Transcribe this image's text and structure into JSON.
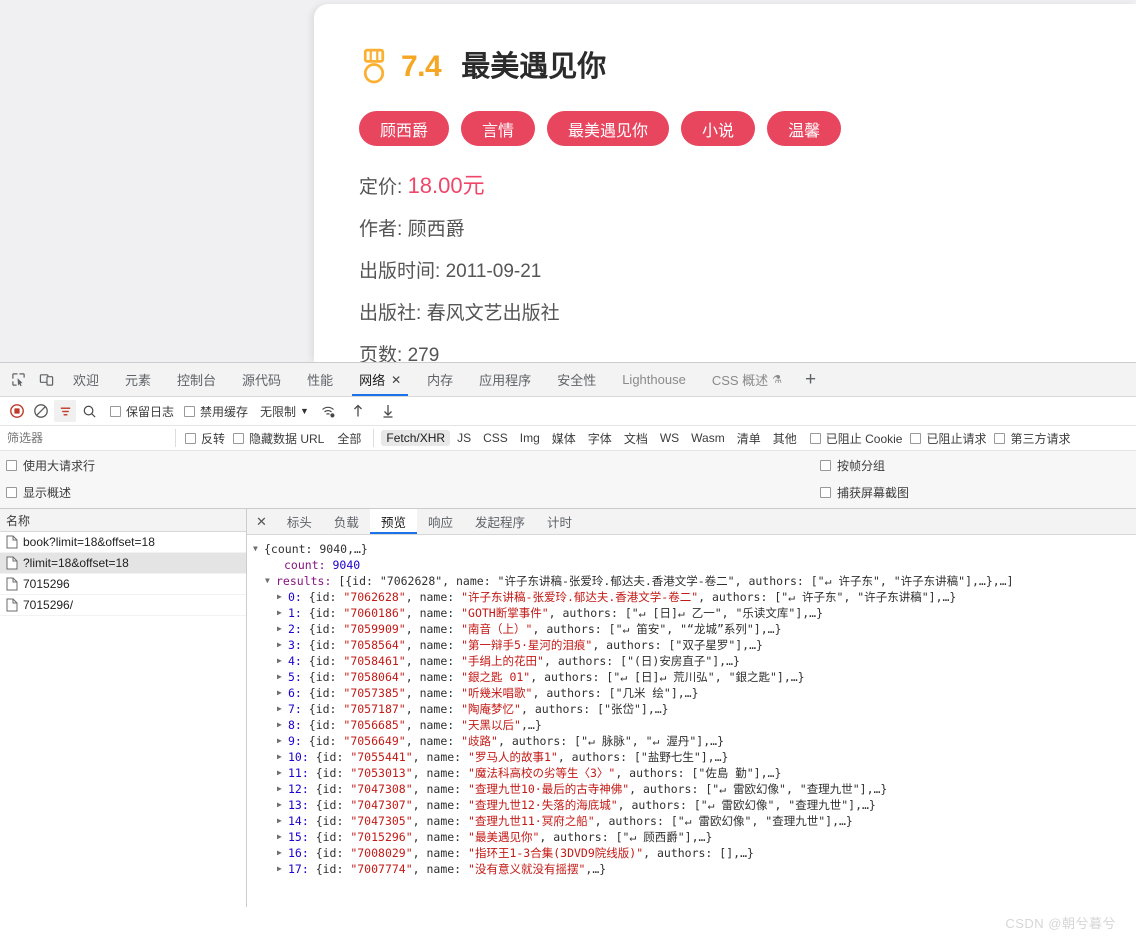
{
  "page": {
    "book": {
      "score": "7.4",
      "title": "最美遇见你",
      "medal_icon": "medal-icon",
      "tags": [
        "顾西爵",
        "言情",
        "最美遇见你",
        "小说",
        "温馨"
      ],
      "meta": [
        {
          "label": "定价:",
          "value": "18.00元",
          "highlight": true
        },
        {
          "label": "作者:",
          "value": "顾西爵",
          "highlight": false
        },
        {
          "label": "出版时间:",
          "value": "2011-09-21",
          "highlight": false
        },
        {
          "label": "出版社:",
          "value": "春风文艺出版社",
          "highlight": false
        },
        {
          "label": "页数:",
          "value": "279",
          "highlight": false
        }
      ],
      "colors": {
        "tag_bg": "#e8455f",
        "price": "#f0466a",
        "score": "#f5a623"
      }
    }
  },
  "devtools": {
    "tabs": [
      {
        "label": "欢迎",
        "active": false,
        "muted": false,
        "closable": false
      },
      {
        "label": "元素",
        "active": false,
        "muted": false,
        "closable": false
      },
      {
        "label": "控制台",
        "active": false,
        "muted": false,
        "closable": false
      },
      {
        "label": "源代码",
        "active": false,
        "muted": false,
        "closable": false
      },
      {
        "label": "性能",
        "active": false,
        "muted": false,
        "closable": false
      },
      {
        "label": "网络",
        "active": true,
        "muted": false,
        "closable": true,
        "close_label": "✕"
      },
      {
        "label": "内存",
        "active": false,
        "muted": false,
        "closable": false
      },
      {
        "label": "应用程序",
        "active": false,
        "muted": false,
        "closable": false
      },
      {
        "label": "安全性",
        "active": false,
        "muted": false,
        "closable": false
      },
      {
        "label": "Lighthouse",
        "active": false,
        "muted": true,
        "closable": false
      },
      {
        "label": "CSS 概述",
        "active": false,
        "muted": true,
        "closable": false,
        "flask": "⚗"
      }
    ],
    "add_tab_label": "+",
    "controls": {
      "record_icon": "record-stop-icon",
      "clear_icon": "clear-icon",
      "filter_icon": "filter-icon",
      "search_icon": "search-icon",
      "preserve_log": "保留日志",
      "disable_cache": "禁用缓存",
      "throttle_value": "无限制",
      "throttle_caret": "▼",
      "wifi_icon": "network-conditions-icon",
      "import_icon": "import-har-icon",
      "export_icon": "export-har-icon"
    },
    "filterbar": {
      "placeholder": "筛选器",
      "value": "",
      "invert": "反转",
      "hide_data_urls": "隐藏数据 URL",
      "types": [
        "全部",
        "Fetch/XHR",
        "JS",
        "CSS",
        "Img",
        "媒体",
        "字体",
        "文档",
        "WS",
        "Wasm",
        "清单",
        "其他"
      ],
      "active_type": "Fetch/XHR",
      "blocked_cookies": "已阻止 Cookie",
      "blocked_requests": "已阻止请求",
      "third_party": "第三方请求"
    },
    "options": {
      "big_request_rows": "使用大请求行",
      "show_overview": "显示概述",
      "group_by_frame": "按帧分组",
      "capture_screenshots": "捕获屏幕截图"
    },
    "request_list": {
      "header": "名称",
      "rows": [
        {
          "name": "book?limit=18&offset=18",
          "selected": false
        },
        {
          "name": "?limit=18&offset=18",
          "selected": true
        },
        {
          "name": "7015296",
          "selected": false
        },
        {
          "name": "7015296/",
          "selected": false
        }
      ]
    },
    "detail": {
      "close_label": "✕",
      "tabs": [
        "标头",
        "负载",
        "预览",
        "响应",
        "发起程序",
        "计时"
      ],
      "active_tab": "预览"
    }
  },
  "preview": {
    "root_line": {
      "indent": 0,
      "tri": "open",
      "text": "{count: 9040,…}"
    },
    "count_line": {
      "indent": 1,
      "key": "count: ",
      "value": "9040"
    },
    "results_line": {
      "indent": 1,
      "tri": "open",
      "key": "results: ",
      "text": "[{id: \"7062628\", name: \"许子东讲稿-张爱玲.郁达夫.香港文学-卷二\", authors: [\"↵ 许子东\", \"许子东讲稿\"],…},…]"
    },
    "items": [
      {
        "index": "0",
        "id": "7062628",
        "name": "许子东讲稿-张爱玲.郁达夫.香港文学-卷二",
        "authors": "[\"↵ 许子东\", \"许子东讲稿\"],…}"
      },
      {
        "index": "1",
        "id": "7060186",
        "name": "GOTH断掌事件",
        "authors": "[\"↵ [日]↵ 乙一\", \"乐读文库\"],…}"
      },
      {
        "index": "2",
        "id": "7059909",
        "name": "南音（上）",
        "authors": "[\"↵ 笛安\", \"“龙城”系列\"],…}"
      },
      {
        "index": "3",
        "id": "7058564",
        "name": "第一辩手5·星河的泪痕",
        "authors": "[\"双子星罗\"],…}"
      },
      {
        "index": "4",
        "id": "7058461",
        "name": "手绢上的花田",
        "authors": "[\"(日)安房直子\"],…}"
      },
      {
        "index": "5",
        "id": "7058064",
        "name": "銀之匙 01",
        "authors": "[\"↵ [日]↵ 荒川弘\", \"銀之匙\"],…}"
      },
      {
        "index": "6",
        "id": "7057385",
        "name": "听幾米唱歌",
        "authors": "[\"几米 绘\"],…}"
      },
      {
        "index": "7",
        "id": "7057187",
        "name": "陶庵梦忆",
        "authors": "[\"张岱\"],…}"
      },
      {
        "index": "8",
        "id": "7056685",
        "name": "天黑以后",
        "authors": null
      },
      {
        "index": "9",
        "id": "7056649",
        "name": "歧路",
        "authors": "[\"↵ 脉脉\", \"↵ 渥丹\"],…}"
      },
      {
        "index": "10",
        "id": "7055441",
        "name": "罗马人的故事1",
        "authors": "[\"盐野七生\"],…}"
      },
      {
        "index": "11",
        "id": "7053013",
        "name": "魔法科高校の劣等生〈3〉",
        "authors": "[\"佐島 勤\"],…}"
      },
      {
        "index": "12",
        "id": "7047308",
        "name": "查理九世10·最后的古寺神佛",
        "authors": "[\"↵ 雷欧幻像\", \"查理九世\"],…}"
      },
      {
        "index": "13",
        "id": "7047307",
        "name": "查理九世12·失落的海底城",
        "authors": "[\"↵ 雷欧幻像\", \"查理九世\"],…}"
      },
      {
        "index": "14",
        "id": "7047305",
        "name": "查理九世11·冥府之船",
        "authors": "[\"↵ 雷欧幻像\", \"查理九世\"],…}"
      },
      {
        "index": "15",
        "id": "7015296",
        "name": "最美遇见你",
        "authors": "[\"↵ 顾西爵\"],…}"
      },
      {
        "index": "16",
        "id": "7008029",
        "name": "指环王1-3合集(3DVD9院线版)",
        "authors": "[],…}"
      },
      {
        "index": "17",
        "id": "7007774",
        "name": "没有意义就没有摇摆",
        "authors": null
      }
    ]
  },
  "watermark": "CSDN @朝兮暮兮"
}
